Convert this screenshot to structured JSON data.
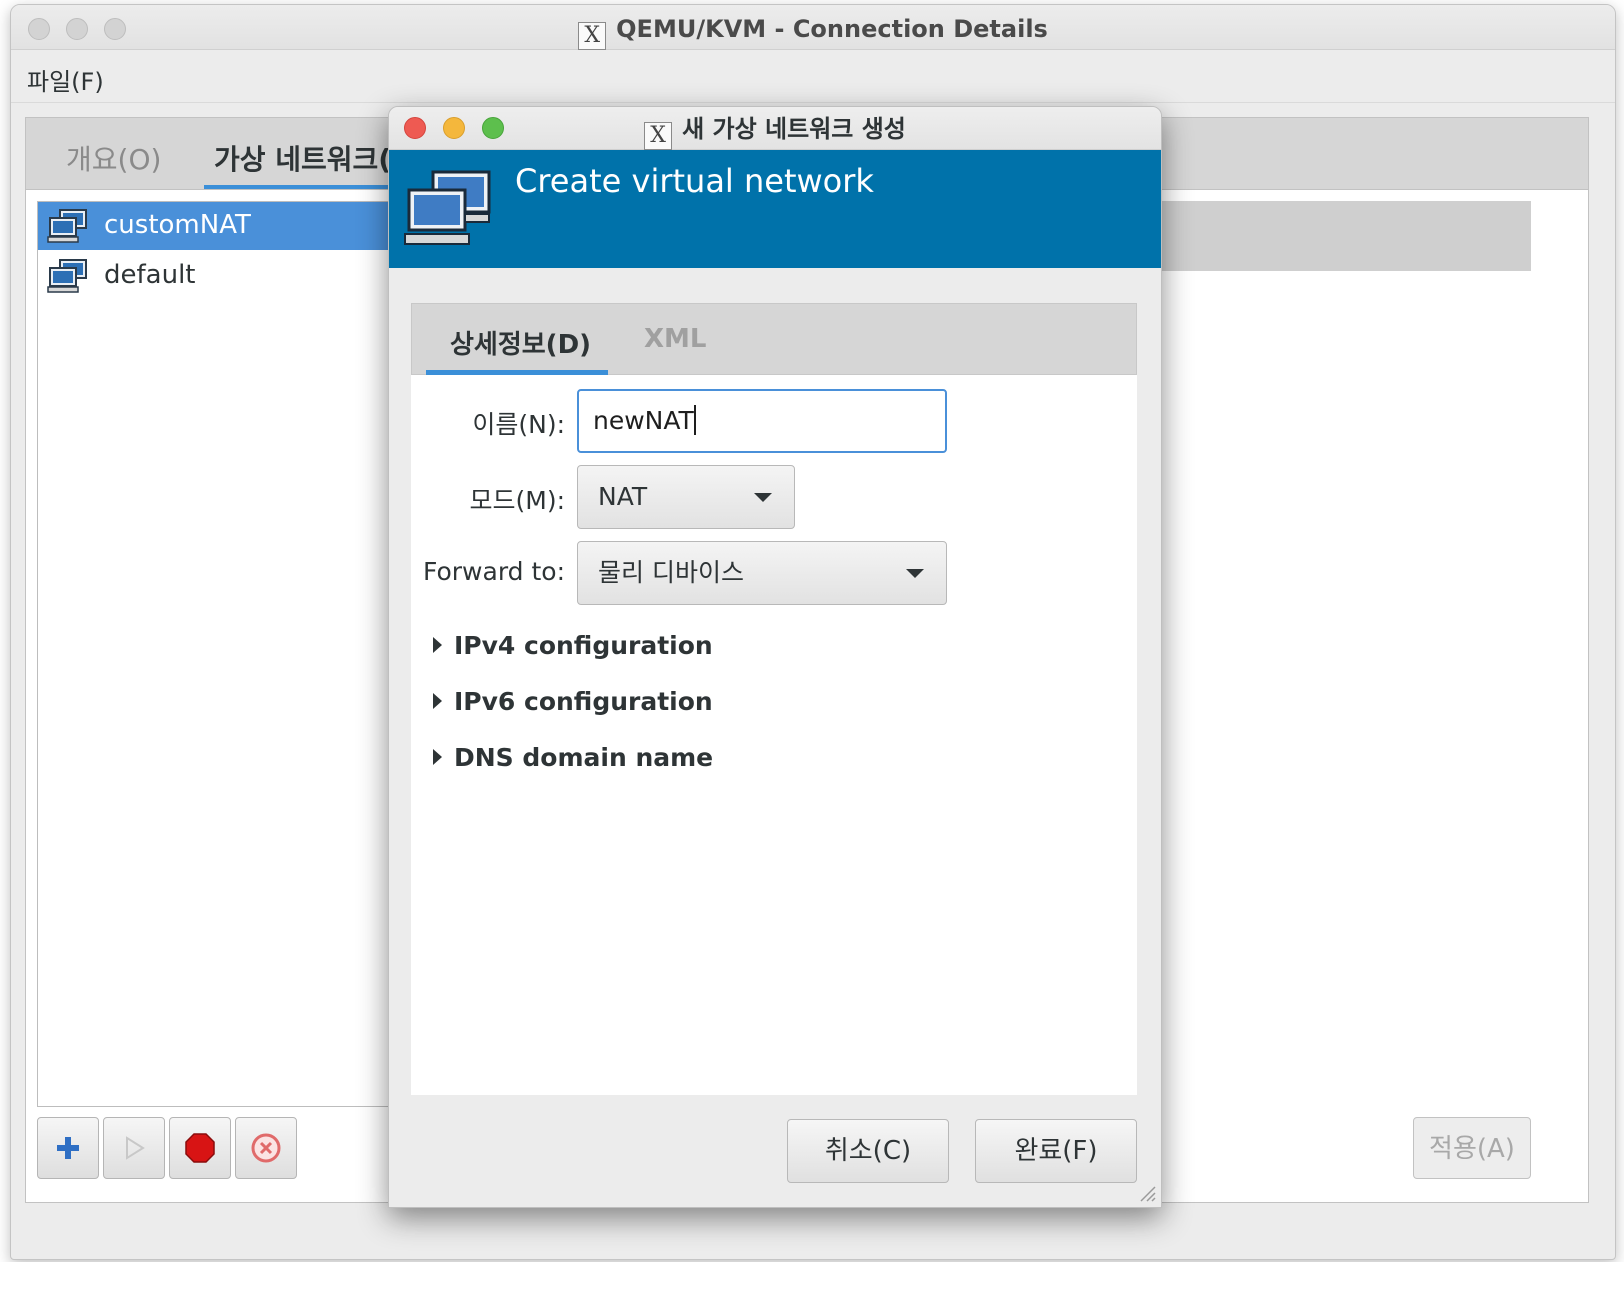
{
  "main_window": {
    "title": "QEMU/KVM - Connection Details",
    "menu": {
      "file": "파일(F)"
    },
    "tabs": [
      {
        "label": "개요(O)"
      },
      {
        "label": "가상 네트워크(V"
      }
    ],
    "networks": [
      {
        "name": "customNAT",
        "selected": true
      },
      {
        "name": "default",
        "selected": false
      }
    ],
    "toolbar": {
      "add_icon": "plus-icon",
      "start_icon": "play-icon",
      "stop_icon": "stop-icon",
      "delete_icon": "delete-icon"
    },
    "apply_label": "적용(A)"
  },
  "dialog": {
    "title": "새 가상 네트워크 생성",
    "banner_title": "Create virtual network",
    "tabs": [
      {
        "label": "상세정보(D)"
      },
      {
        "label": "XML"
      }
    ],
    "form": {
      "name_label": "이름(N):",
      "name_value": "newNAT",
      "mode_label": "모드(M):",
      "mode_value": "NAT",
      "forward_label": "Forward to:",
      "forward_value": "물리 디바이스"
    },
    "expanders": [
      {
        "label": "IPv4 configuration"
      },
      {
        "label": "IPv6 configuration"
      },
      {
        "label": "DNS domain name"
      }
    ],
    "cancel_label": "취소(C)",
    "finish_label": "완료(F)"
  },
  "colors": {
    "selection": "#4a90d9",
    "banner": "#0072aa",
    "tab_underline": "#3b8fd8",
    "close": "#ee5a52",
    "minimize": "#f4b73c",
    "zoom": "#5dbf4d"
  }
}
